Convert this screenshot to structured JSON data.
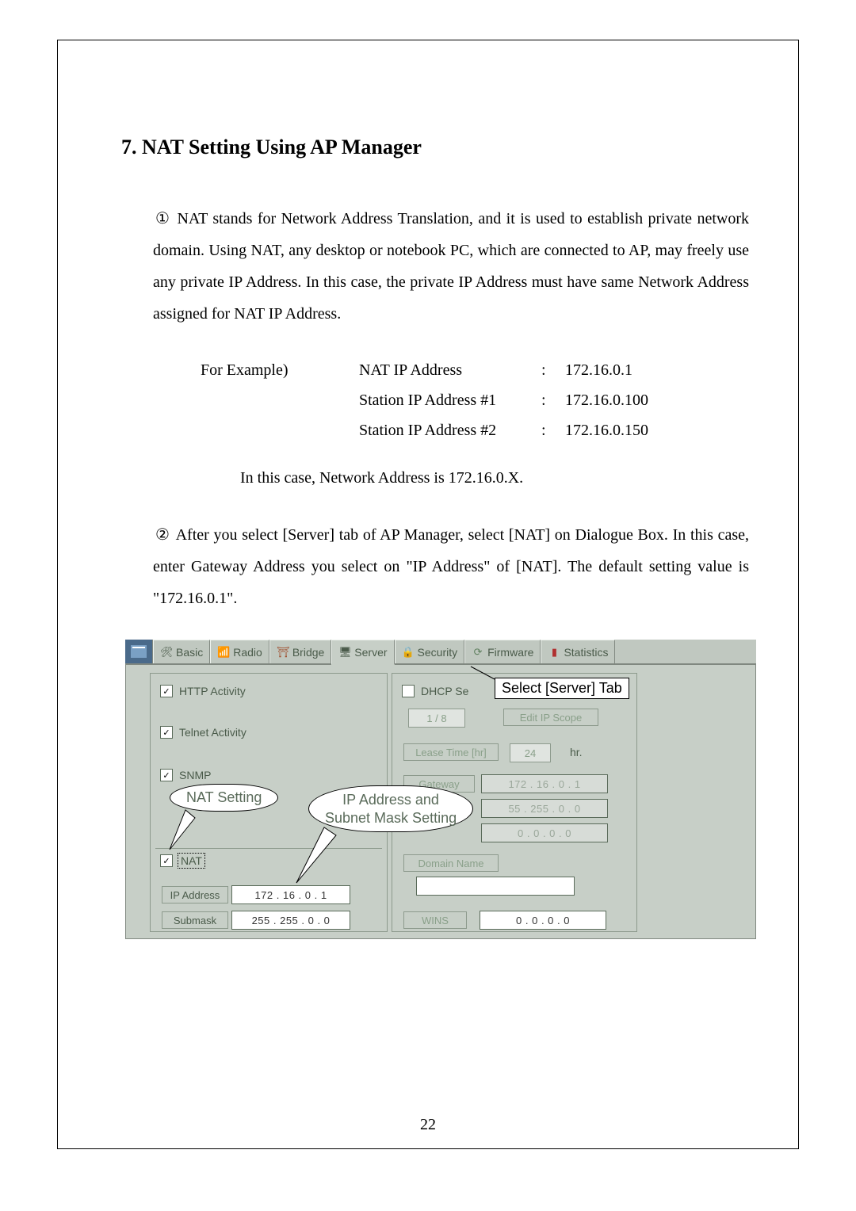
{
  "title": "7. NAT Setting Using AP Manager",
  "para1_marker": "①",
  "para1_text": "NAT stands for Network Address Translation, and it is used to establish private network domain. Using NAT, any desktop or notebook PC, which are connected to AP, may freely use any private IP Address. In this case, the private IP Address must have same Network Address assigned for NAT IP Address.",
  "example_label": "For Example)",
  "example_rows": [
    {
      "k": "NAT IP Address",
      "sep": ":",
      "v": "172.16.0.1"
    },
    {
      "k": "Station IP Address #1",
      "sep": ":",
      "v": "172.16.0.100"
    },
    {
      "k": "Station IP Address #2",
      "sep": ":",
      "v": "172.16.0.150"
    }
  ],
  "network_note": "In this case, Network Address is 172.16.0.X.",
  "para2_marker": "②",
  "para2_text": "After you select [Server] tab of AP Manager, select [NAT] on Dialogue Box. In this case, enter Gateway Address you select on \"IP Address\" of [NAT]. The default setting value is \"172.16.0.1\".",
  "page_number": "22",
  "ui": {
    "tabs": {
      "basic": "Basic",
      "radio": "Radio",
      "bridge": "Bridge",
      "server": "Server",
      "security": "Security",
      "firmware": "Firmware",
      "statistics": "Statistics"
    },
    "left": {
      "http": "HTTP Activity",
      "telnet": "Telnet Activity",
      "snmp": "SNMP",
      "nat": "NAT",
      "ip_label": "IP Address",
      "ip_value": "172 . 16  .  0   .  1",
      "sub_label": "Submask",
      "sub_value": "255 . 255 .  0   .  0"
    },
    "right": {
      "dhcp": "DHCP Se",
      "scope_count": "1 / 8",
      "edit_scope": "Edit IP Scope",
      "lease_label": "Lease Time [hr]",
      "lease_value": "24",
      "lease_unit": "hr.",
      "gateway_label": "Gateway",
      "gateway_value": "172 . 16  .  0   .  1",
      "mask_value": "55 . 255 .  0   .  0",
      "zero_ip": "0   .  0   .  0   .  0",
      "domain_label": "Domain Name",
      "wins_label": "WINS",
      "wins_value": "0   .  0   .  0   .  0"
    },
    "callouts": {
      "select_server": "Select [Server] Tab",
      "nat_setting": "NAT Setting",
      "ip_subnet": "IP Address and\nSubnet Mask Setting"
    }
  }
}
